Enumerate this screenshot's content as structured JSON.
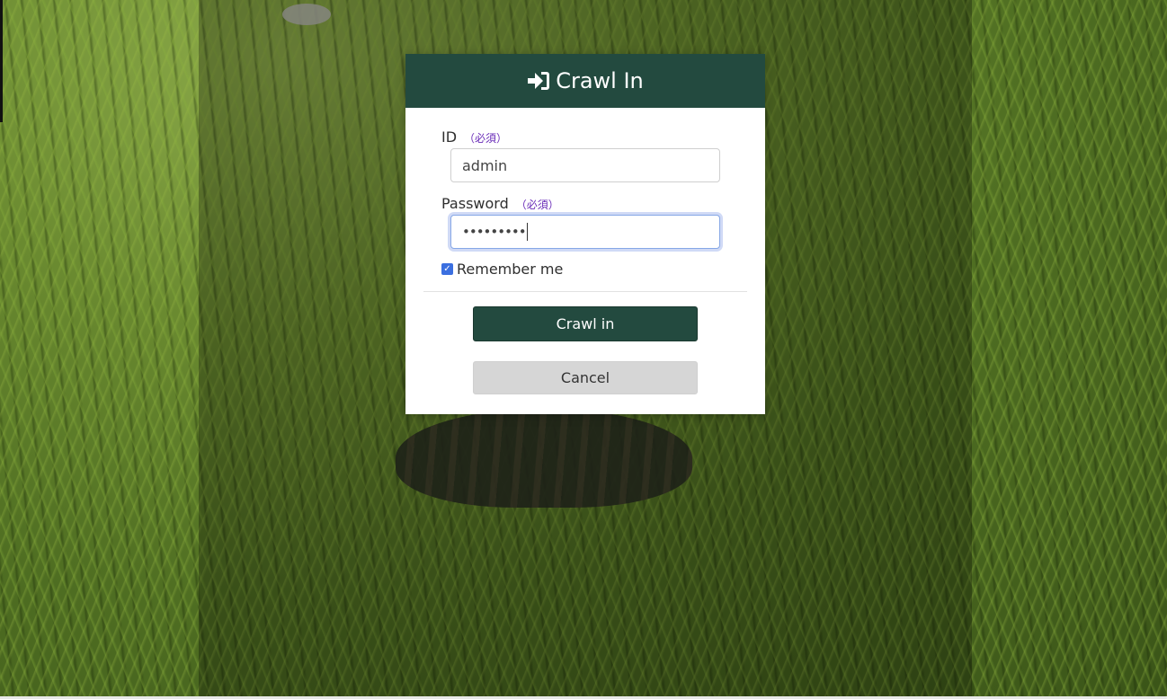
{
  "dialog": {
    "title": "Crawl In",
    "title_icon": "sign-in-icon",
    "header_color": "#234a3f"
  },
  "form": {
    "id_label": "ID",
    "id_required": "（必須）",
    "id_value": "admin",
    "password_label": "Password",
    "password_required": "（必須）",
    "password_value": "•••••••••",
    "remember_label": "Remember me",
    "remember_checked": true
  },
  "buttons": {
    "submit_label": "Crawl in",
    "cancel_label": "Cancel"
  }
}
